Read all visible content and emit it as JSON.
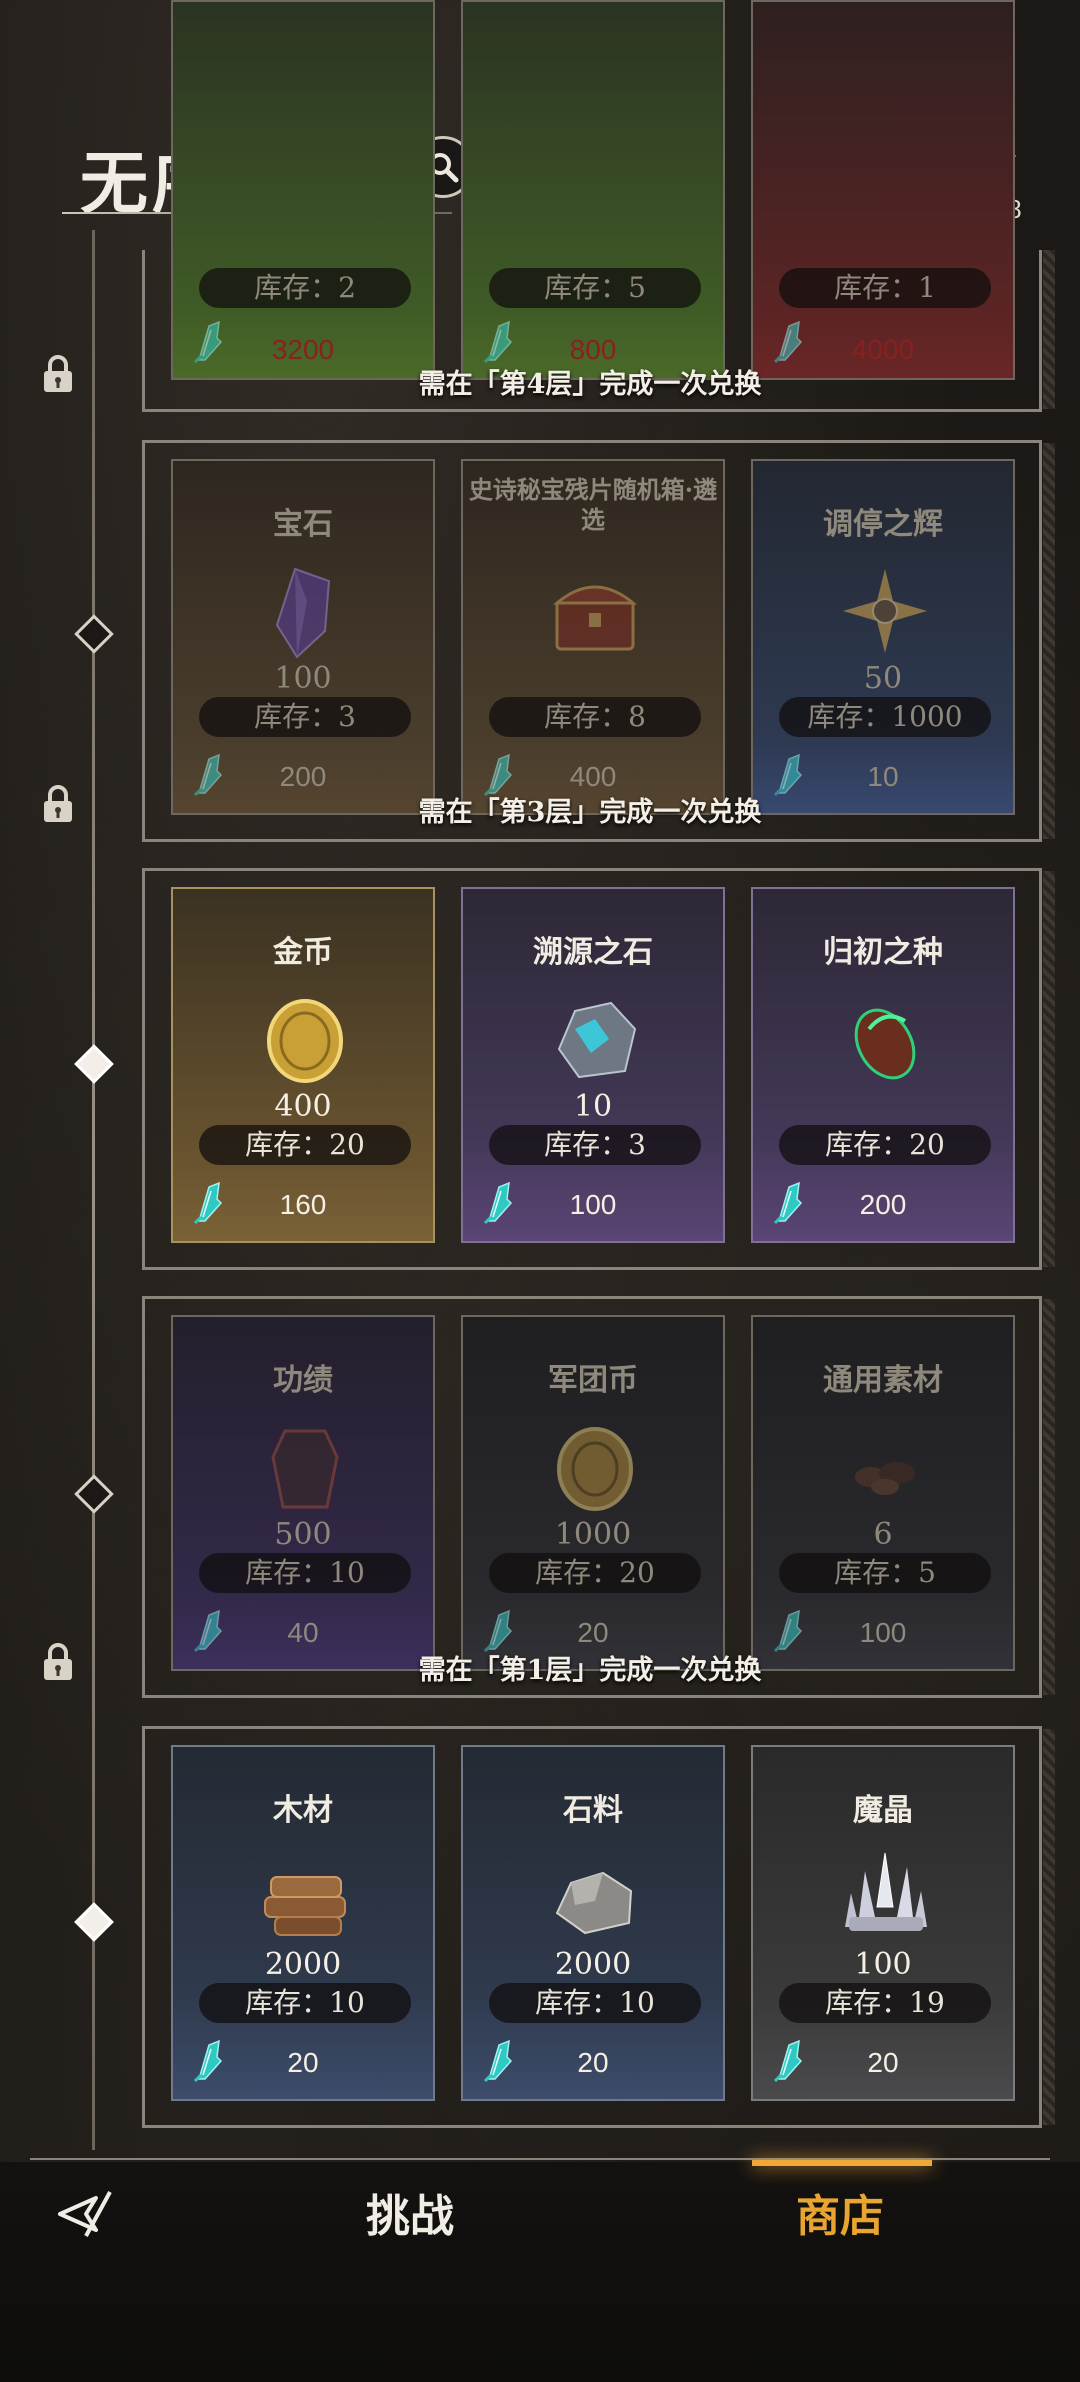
{
  "header": {
    "title": "无序迷境",
    "search_icon": "search-icon",
    "guide_icon": "book-icon",
    "currency_icon": "crystal-feather-icon",
    "currency_amount": "728"
  },
  "locks": {
    "tier4": "需在「第4层」完成一次兑换",
    "tier3": "需在「第3层」完成一次兑换",
    "tier1": "需在「第1层」完成一次兑换"
  },
  "tier5": [
    {
      "stock": "库存：2",
      "price": "3200"
    },
    {
      "stock": "库存：5",
      "price": "800"
    },
    {
      "stock": "库存：1",
      "price": "4000"
    }
  ],
  "tier4": [
    {
      "name": "宝石",
      "qty": "100",
      "stock": "库存：3",
      "price": "200"
    },
    {
      "name": "史诗秘宝残片随机箱·遴选",
      "qty": "",
      "stock": "库存：8",
      "price": "400"
    },
    {
      "name": "调停之辉",
      "qty": "50",
      "stock": "库存：1000",
      "price": "10"
    }
  ],
  "tier3": [
    {
      "name": "金币",
      "qty": "400",
      "stock": "库存：20",
      "price": "160"
    },
    {
      "name": "溯源之石",
      "qty": "10",
      "stock": "库存：3",
      "price": "100"
    },
    {
      "name": "归初之种",
      "qty": "",
      "stock": "库存：20",
      "price": "200"
    }
  ],
  "tier2": [
    {
      "name": "功绩",
      "qty": "500",
      "stock": "库存：10",
      "price": "40"
    },
    {
      "name": "军团币",
      "qty": "1000",
      "stock": "库存：20",
      "price": "20"
    },
    {
      "name": "通用素材",
      "qty": "6",
      "stock": "库存：5",
      "price": "100"
    }
  ],
  "tier1": [
    {
      "name": "木材",
      "qty": "2000",
      "stock": "库存：10",
      "price": "20"
    },
    {
      "name": "石料",
      "qty": "2000",
      "stock": "库存：10",
      "price": "20"
    },
    {
      "name": "魔晶",
      "qty": "100",
      "stock": "库存：19",
      "price": "20"
    }
  ],
  "tabs": {
    "challenge": "挑战",
    "shop": "商店"
  },
  "colors": {
    "accent_active_tab": "#e8a531",
    "text_primary": "#f2ede4",
    "currency_cyan": "#3fd6d0"
  }
}
